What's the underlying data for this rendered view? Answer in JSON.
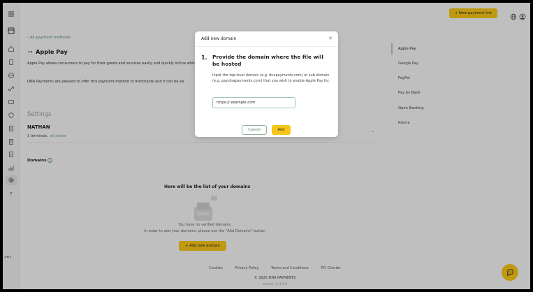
{
  "top": {
    "new_payment_link": "+ New payment link"
  },
  "page": {
    "back_link": "All payment methods",
    "title": "Apple Pay",
    "description": "Apple Pay allows consumers to pay for their goods and services easily and quickly online which can be invoked from their Apple devices or within the Safari web browser.",
    "description2": "DNA Payments are pleased to offer this payment method to merchants and it can be ea",
    "settings_heading": "Settings",
    "terminal_name": "NATHAN",
    "terminal_count": "1 terminals,",
    "terminal_active": "all active",
    "domains_heading": "Domains",
    "empty_heading": "Here will be the list of your domains",
    "empty_line1": "You have no verified domains",
    "empty_line2": "In order to add your domains, please use the \"Add Domains\" button",
    "add_domain_button": "+ Add new domain"
  },
  "right_nav": {
    "items": [
      "Apple Pay",
      "Google Pay",
      "PayPal",
      "Pay by Bank",
      "Open Banking",
      "Klarna"
    ],
    "active": "Apple Pay"
  },
  "footer": {
    "links": [
      "Cookies",
      "Privacy Policy",
      "Terms and Conditions",
      "PCI Charter"
    ],
    "copyright": "© 2025 DNA PAYMENTS",
    "version": "Version: 1.10.0.0"
  },
  "modal": {
    "title": "Add new domain",
    "step_number": "1.",
    "step_title": "Provide the domain where the file will be hosted",
    "step_description": "Input the top-level domain (e.g. dnapayments.com) or sub-domain (e.g. pay.dnapayments.com) that you wish to enable Apple Pay for.",
    "input_value": "https:// example.com",
    "cancel_label": "Cancel",
    "add_label": "Add"
  },
  "colors": {
    "accent": "#f5c518",
    "brand_green": "#6a9b7d"
  }
}
